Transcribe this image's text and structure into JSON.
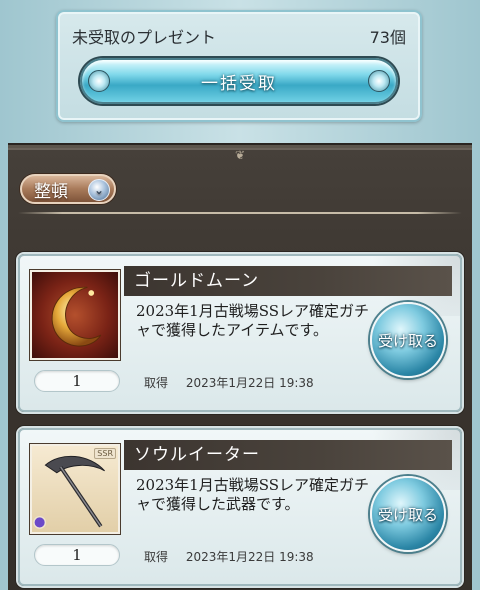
{
  "header": {
    "unclaimed_label": "未受取のプレゼント",
    "unclaimed_count": "73個",
    "bulk_receive_label": "一括受取"
  },
  "toolbar": {
    "sort_label": "整頓",
    "sort_icon": "chevron-down-icon"
  },
  "items": [
    {
      "name": "ゴールドムーン",
      "icon": "gold-moon-icon",
      "description": "2023年1月古戦場SSレア確定ガチャで獲得したアイテムです。",
      "quantity": "1",
      "acquired_label": "取得",
      "acquired_date": "2023年1月22日 19:38",
      "receive_label": "受け取る"
    },
    {
      "name": "ソウルイーター",
      "icon": "scythe-icon",
      "rarity_tag": "SSR",
      "description": "2023年1月古戦場SSレア確定ガチャで獲得した武器です。",
      "quantity": "1",
      "acquired_label": "取得",
      "acquired_date": "2023年1月22日 19:38",
      "receive_label": "受け取る"
    }
  ],
  "colors": {
    "accent_blue": "#3aa9c6",
    "panel_dark": "#3a342e",
    "sort_brown": "#a87a5a"
  }
}
